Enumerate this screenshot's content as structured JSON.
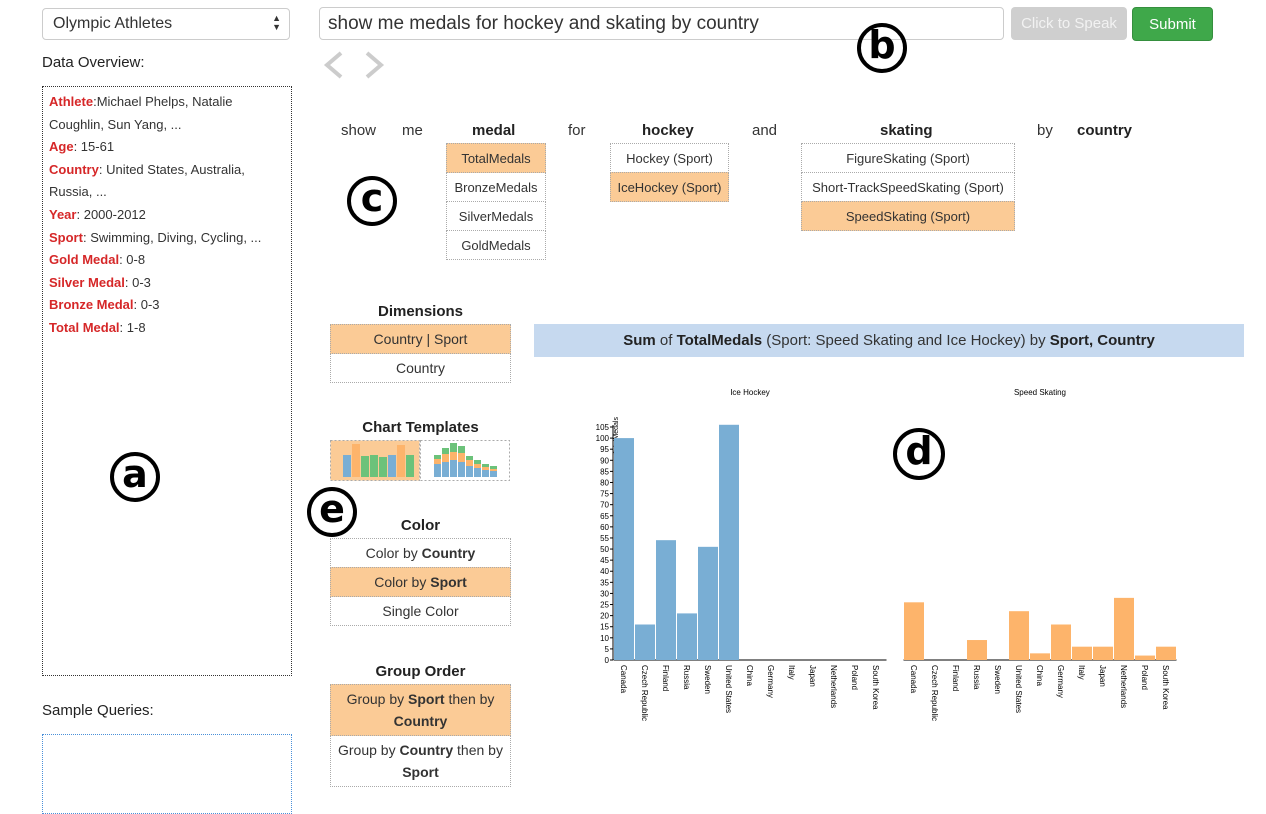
{
  "dataset": {
    "selected": "Olympic Athletes"
  },
  "overview": {
    "label": "Data Overview:",
    "fields": [
      {
        "key": "Athlete",
        "sep": ":",
        "value": "Michael Phelps, Natalie Coughlin, Sun Yang, ..."
      },
      {
        "key": "Age",
        "sep": ": ",
        "value": "15-61"
      },
      {
        "key": "Country",
        "sep": ": ",
        "value": "United States, Australia, Russia, ..."
      },
      {
        "key": "Year",
        "sep": ": ",
        "value": "2000-2012"
      },
      {
        "key": "Sport",
        "sep": ": ",
        "value": "Swimming, Diving, Cycling, ..."
      },
      {
        "key": "Gold Medal",
        "sep": ": ",
        "value": "0-8"
      },
      {
        "key": "Silver Medal",
        "sep": ": ",
        "value": "0-3"
      },
      {
        "key": "Bronze Medal",
        "sep": ": ",
        "value": "0-3"
      },
      {
        "key": "Total Medal",
        "sep": ": ",
        "value": "1-8"
      }
    ]
  },
  "sample_queries": {
    "label": "Sample Queries:"
  },
  "query": {
    "value": "show me medals for hockey and skating by country",
    "speak_label": "Click to Speak",
    "submit_label": "Submit"
  },
  "annotations": {
    "a": "a",
    "b": "b",
    "c": "c",
    "d": "d",
    "e": "e"
  },
  "tokens": {
    "show": "show",
    "me": "me",
    "medal": "medal",
    "for": "for",
    "hockey": "hockey",
    "and": "and",
    "skating": "skating",
    "by": "by",
    "country": "country"
  },
  "ambiguity": {
    "medal": [
      "TotalMedals",
      "BronzeMedals",
      "SilverMedals",
      "GoldMedals"
    ],
    "medal_selected": 0,
    "hockey": [
      "Hockey (Sport)",
      "IceHockey (Sport)"
    ],
    "hockey_selected": 1,
    "skating": [
      "FigureSkating (Sport)",
      "Short-TrackSpeedSkating (Sport)",
      "SpeedSkating (Sport)"
    ],
    "skating_selected": 2
  },
  "dimensions": {
    "title": "Dimensions",
    "options": [
      "Country | Sport",
      "Country"
    ],
    "selected": 0
  },
  "templates": {
    "title": "Chart Templates",
    "selected": 0
  },
  "color": {
    "title": "Color",
    "options": [
      {
        "prefix": "Color by ",
        "bold": "Country"
      },
      {
        "prefix": "Color by ",
        "bold": "Sport"
      },
      {
        "prefix": "Single Color",
        "bold": ""
      }
    ],
    "selected": 1
  },
  "group_order": {
    "title": "Group Order",
    "options": [
      {
        "a": "Group by ",
        "b": "Sport",
        "c": " then by ",
        "d": "Country"
      },
      {
        "a": "Group by ",
        "b": "Country",
        "c": " then by ",
        "d": "Sport"
      }
    ],
    "selected": 0
  },
  "chart_header": {
    "agg": "Sum",
    "of": " of ",
    "measure": "TotalMedals",
    "filter": " (Sport: Speed Skating and Ice Hockey) by ",
    "dims": "Sport, Country"
  },
  "chart_data": {
    "type": "bar",
    "ylabel": "TotalMedals",
    "ylim": [
      0,
      105
    ],
    "yticks": [
      0,
      5,
      10,
      15,
      20,
      25,
      30,
      35,
      40,
      45,
      50,
      55,
      60,
      65,
      70,
      75,
      80,
      85,
      90,
      95,
      100,
      105
    ],
    "categories": [
      "Canada",
      "Czech Republic",
      "Finland",
      "Russia",
      "Sweden",
      "United States",
      "China",
      "Germany",
      "Italy",
      "Japan",
      "Netherlands",
      "Poland",
      "South Korea"
    ],
    "series": [
      {
        "name": "Ice Hockey",
        "color": "#79aed4",
        "values": [
          100,
          16,
          54,
          21,
          51,
          106,
          0,
          0,
          0,
          0,
          0,
          0,
          0
        ]
      },
      {
        "name": "Speed Skating",
        "color": "#fdb46b",
        "values": [
          26,
          0,
          0,
          9,
          0,
          22,
          3,
          16,
          6,
          6,
          28,
          2,
          6
        ]
      }
    ]
  }
}
